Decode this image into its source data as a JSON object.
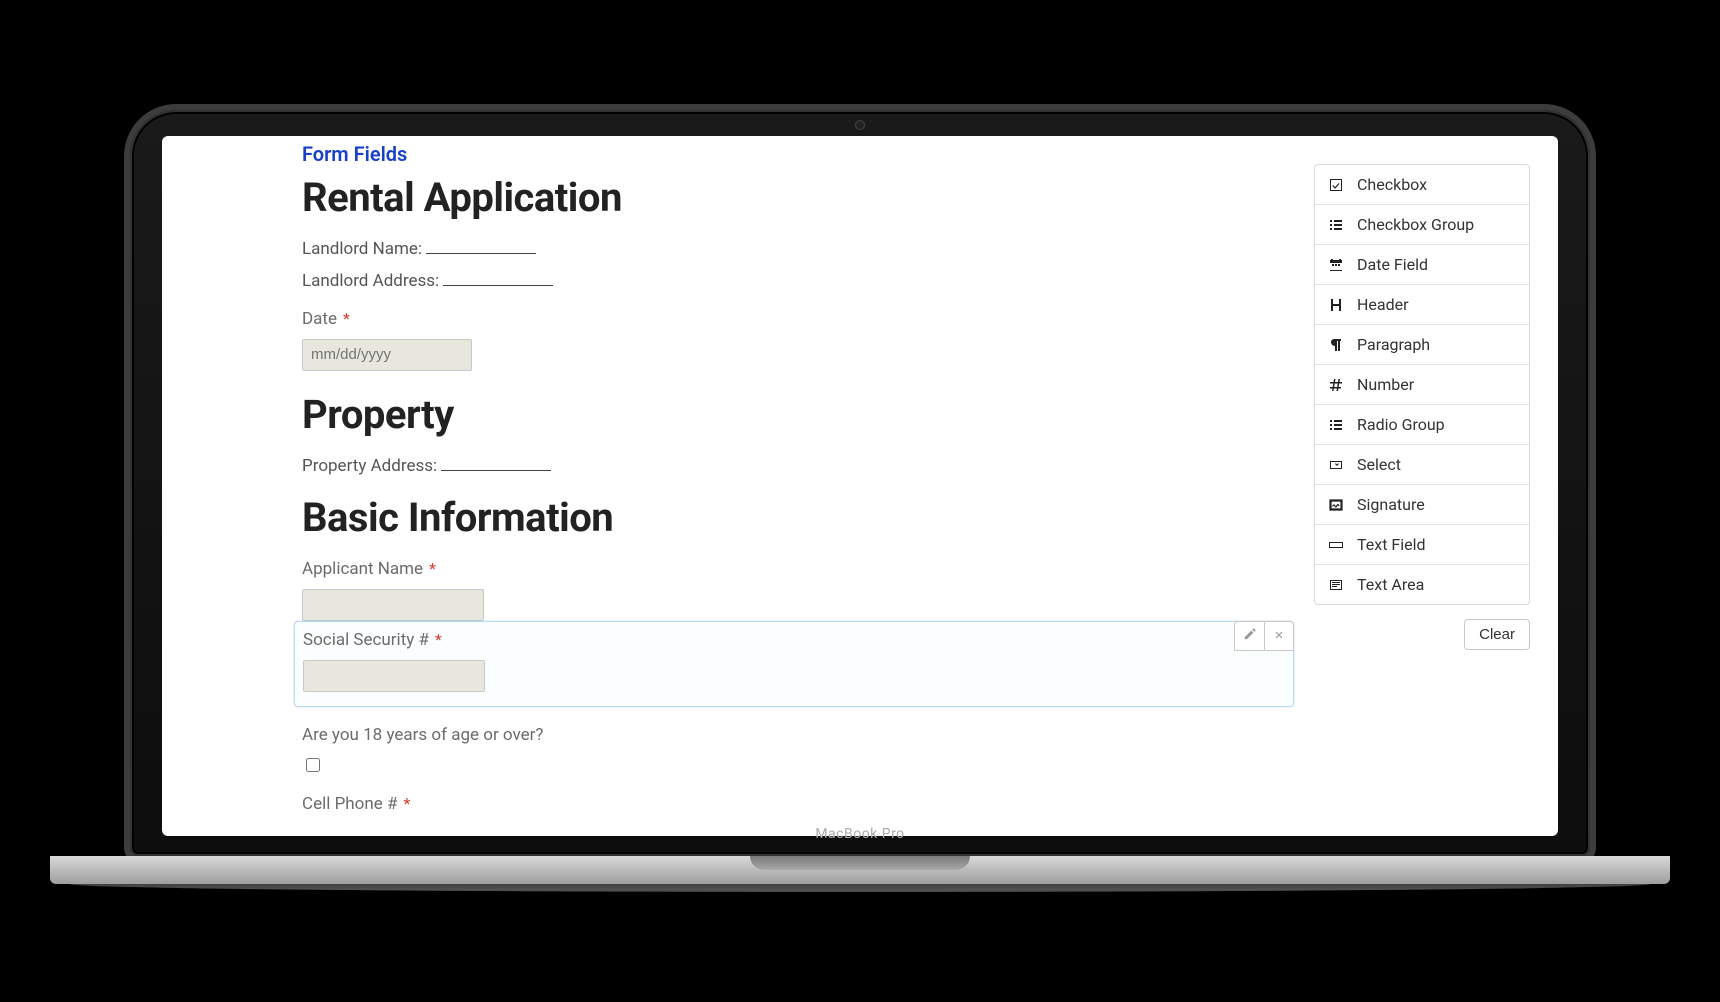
{
  "breadcrumb": "Form Fields",
  "form": {
    "title": "Rental Application",
    "landlord_name_label": "Landlord Name:",
    "landlord_address_label": "Landlord Address:",
    "date_label": "Date",
    "date_placeholder": "mm/dd/yyyy",
    "property_header": "Property",
    "property_address_label": "Property Address:",
    "basic_info_header": "Basic Information",
    "applicant_name_label": "Applicant Name",
    "ssn_label": "Social Security #",
    "age_label": "Are you 18 years of age or over?",
    "cell_label": "Cell Phone #"
  },
  "palette": {
    "items": [
      {
        "label": "Checkbox",
        "icon": "checkbox"
      },
      {
        "label": "Checkbox Group",
        "icon": "list-check"
      },
      {
        "label": "Date Field",
        "icon": "calendar"
      },
      {
        "label": "Header",
        "icon": "letter-h"
      },
      {
        "label": "Paragraph",
        "icon": "pilcrow"
      },
      {
        "label": "Number",
        "icon": "hash"
      },
      {
        "label": "Radio Group",
        "icon": "list-check"
      },
      {
        "label": "Select",
        "icon": "select"
      },
      {
        "label": "Signature",
        "icon": "signature"
      },
      {
        "label": "Text Field",
        "icon": "text-field"
      },
      {
        "label": "Text Area",
        "icon": "text-area"
      }
    ],
    "clear_label": "Clear"
  },
  "device_label": "MacBook Pro"
}
